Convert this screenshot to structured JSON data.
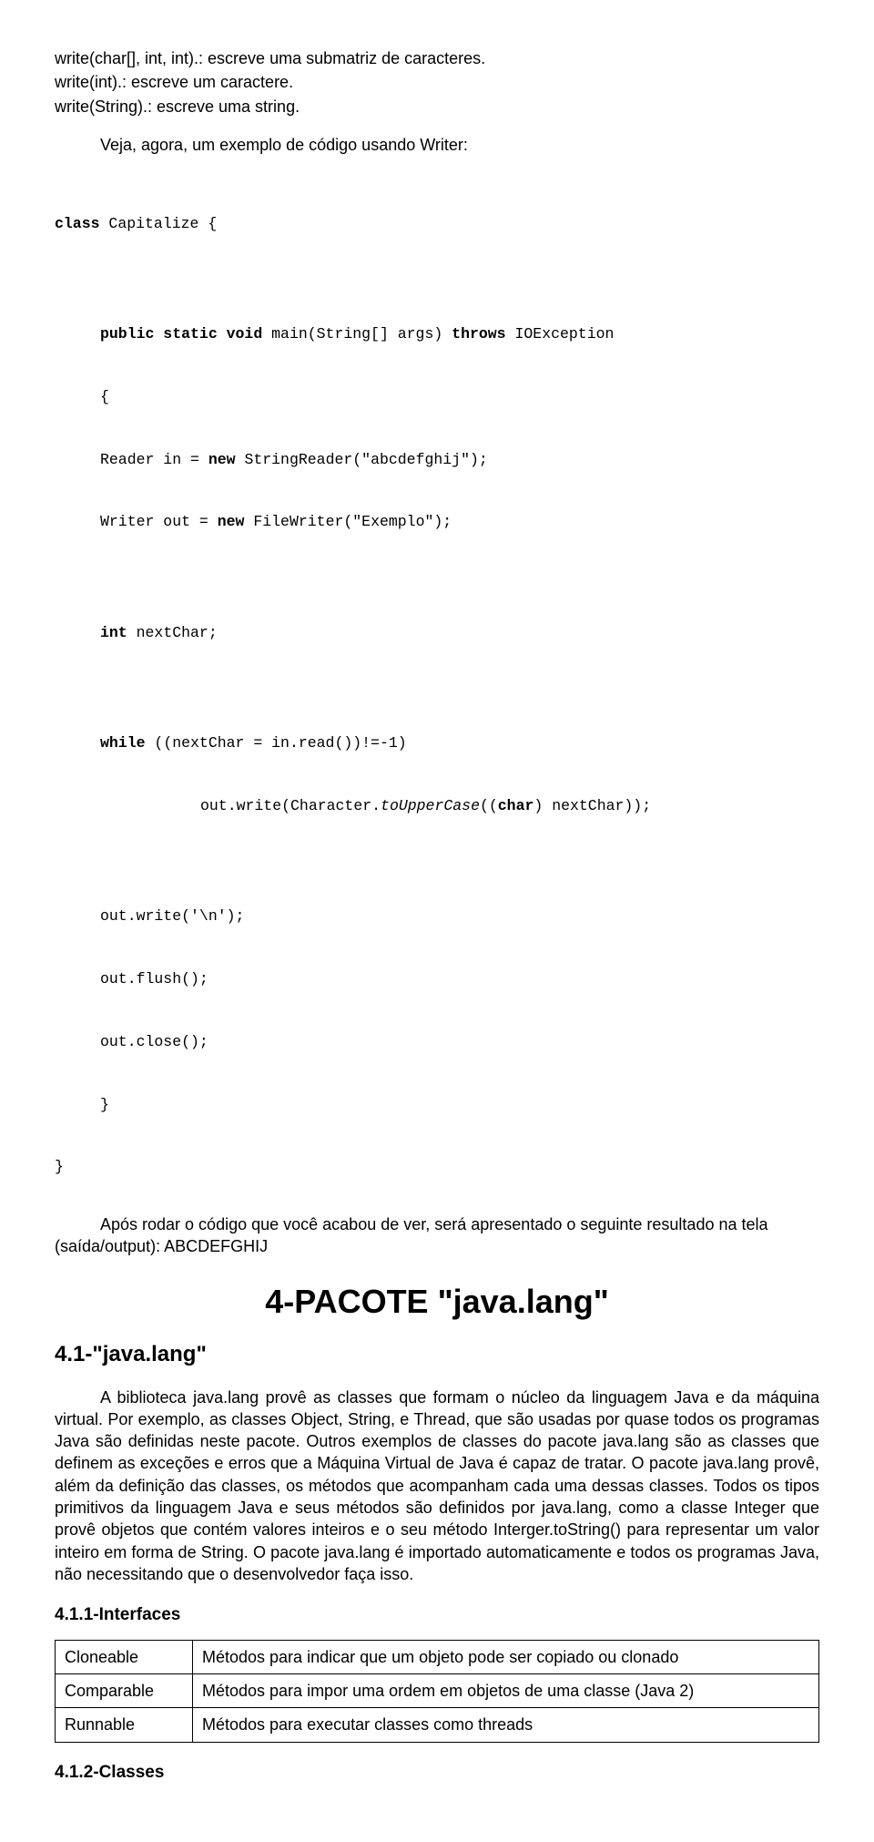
{
  "intro": {
    "l1": "write(char[], int, int).: escreve uma submatriz de caracteres.",
    "l2": "write(int).: escreve um caractere.",
    "l3": "write(String).: escreve uma string."
  },
  "lead": "Veja, agora, um exemplo de código usando Writer:",
  "code": {
    "c01a": "class",
    "c01b": " Capitalize {",
    "c02a": "public static void",
    "c02b": " main(String[] args) ",
    "c02c": "throws",
    "c02d": " IOException",
    "c03": "{",
    "c04a": "Reader in = ",
    "c04b": "new",
    "c04c": " StringReader(\"abcdefghij\");",
    "c05a": "Writer out = ",
    "c05b": "new",
    "c05c": " FileWriter(\"Exemplo\");",
    "c06a": "int",
    "c06b": " nextChar;",
    "c07a": "while",
    "c07b": " ((nextChar = in.read())!=-1)",
    "c08a": "out.write(Character.",
    "c08b": "toUpperCase",
    "c08c": "((",
    "c08d": "char",
    "c08e": ") nextChar));",
    "c09": "out.write('\\n');",
    "c10": "out.flush();",
    "c11": "out.close();",
    "c12": "}",
    "c13": "}"
  },
  "after_code": "Após rodar o código que você acabou de ver, será apresentado o seguinte resultado na tela (saída/output): ABCDEFGHIJ",
  "title": "4-PACOTE \"java.lang\"",
  "section41": "4.1-\"java.lang\"",
  "para41": "A biblioteca java.lang provê as classes que formam o núcleo da linguagem Java e da máquina virtual. Por exemplo, as classes Object, String, e Thread, que são usadas por quase todos os programas Java são definidas neste pacote. Outros exemplos de classes do pacote java.lang são as classes que definem as exceções e erros que a Máquina Virtual de Java é capaz de tratar. O pacote java.lang provê, além da definição das classes, os métodos que acompanham cada uma dessas classes. Todos os tipos primitivos da linguagem Java e seus métodos são definidos por java.lang, como a classe Integer que provê objetos que contém valores inteiros e o seu método Interger.toString() para representar um valor inteiro em forma de String. O pacote java.lang é importado automaticamente e todos os programas Java, não necessitando que o desenvolvedor faça isso.",
  "sub411": "4.1.1-Interfaces",
  "table": {
    "rows": [
      {
        "name": "Cloneable",
        "desc": "Métodos para indicar que um objeto pode ser copiado ou clonado"
      },
      {
        "name": "Comparable",
        "desc": "Métodos para impor uma ordem em objetos de uma classe (Java 2)"
      },
      {
        "name": "Runnable",
        "desc": "Métodos para executar classes como threads"
      }
    ]
  },
  "sub412": "4.1.2-Classes"
}
